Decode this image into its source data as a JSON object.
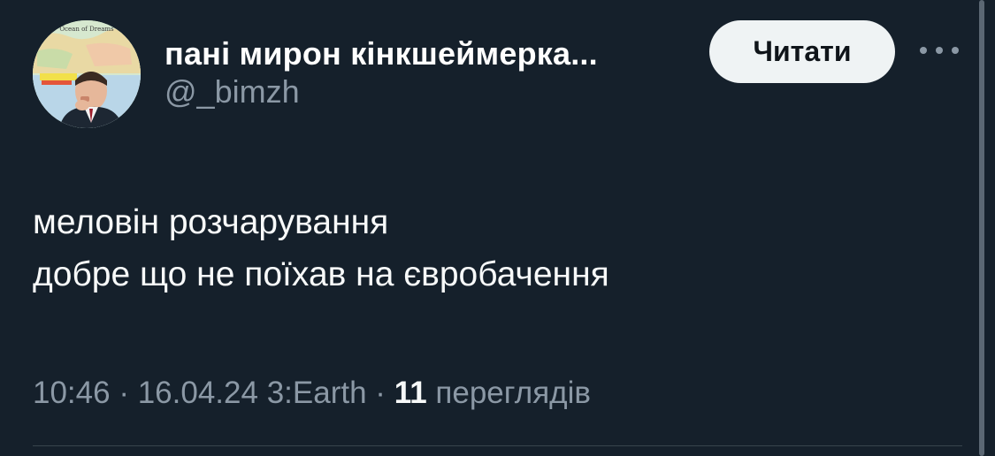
{
  "author": {
    "display_name": "пані мирон кінкшеймерка...",
    "handle": "@_bimzh",
    "avatar_text": "Ocean of Dreams"
  },
  "follow_button": {
    "label": "Читати"
  },
  "more_button": {
    "icon": "more-horizontal-icon"
  },
  "tweet": {
    "lines": [
      "меловін розчарування",
      "добре що не поїхав на євробачення"
    ]
  },
  "meta": {
    "time": "10:46",
    "sep1": "·",
    "date": "16.04.24",
    "source": "3:Earth",
    "sep2": "·",
    "views_count": "11",
    "views_label": "переглядів"
  },
  "colors": {
    "background": "#15202b",
    "text": "#f7f9f9",
    "secondary": "#8b98a5",
    "button_bg": "#eff3f4",
    "divider": "#38444d"
  }
}
